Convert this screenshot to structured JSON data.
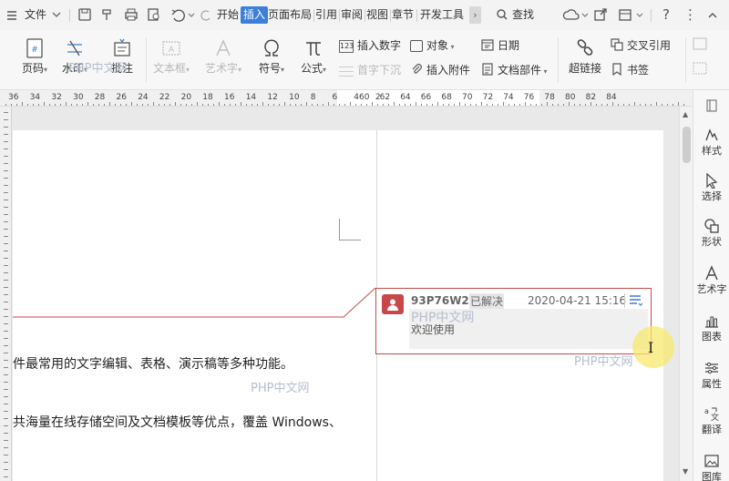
{
  "menubar": {
    "file_label": "文件",
    "tabs": [
      "开始",
      "插入",
      "页面布局",
      "引用",
      "审阅",
      "视图",
      "章节",
      "开发工具"
    ],
    "active_tab": "插入",
    "more_label": "›",
    "search_label": "查找"
  },
  "ribbon": {
    "page_number": "页码",
    "watermark": "水印",
    "comment": "批注",
    "textbox": "文本框",
    "wordart": "艺术字",
    "symbol": "符号",
    "formula": "公式",
    "insert_number": "插入数字",
    "object": "对象",
    "date": "日期",
    "dropcap": "首字下沉",
    "attachment": "插入附件",
    "doc_parts": "文档部件",
    "hyperlink": "超链接",
    "cross_ref": "交叉引用",
    "bookmark": "书签"
  },
  "ruler": {
    "labels": [
      "36",
      "34",
      "32",
      "30",
      "28",
      "26",
      "24",
      "22",
      "20",
      "18",
      "16",
      "14",
      "12",
      "10",
      "8",
      "6",
      "4",
      "2",
      "60",
      "62",
      "64",
      "66",
      "68",
      "70",
      "72",
      "74",
      "76",
      "78",
      "80",
      "82",
      "84"
    ]
  },
  "document": {
    "line1": "件最常用的文字编辑、表格、演示稿等多种功能。",
    "line2": "共海量在线存储空间及文档模板等优点，覆盖 Windows、",
    "watermarks": [
      "PHP中文网",
      "PHP中文网",
      "PHP中文网"
    ]
  },
  "comment": {
    "author": "93P76W2",
    "status": "已解决",
    "date": "2020-04-21 15:16",
    "text": "欢迎使用",
    "watermark": "PHP中文网"
  },
  "right_pane": {
    "items": [
      "样式",
      "选择",
      "形状",
      "艺术字",
      "图表",
      "属性",
      "翻译",
      "图库"
    ]
  },
  "colors": {
    "accent": "#3b7fd8",
    "comment_border": "#c74a4a",
    "avatar": "#c64848",
    "cursor_highlight": "#f8e86e"
  }
}
